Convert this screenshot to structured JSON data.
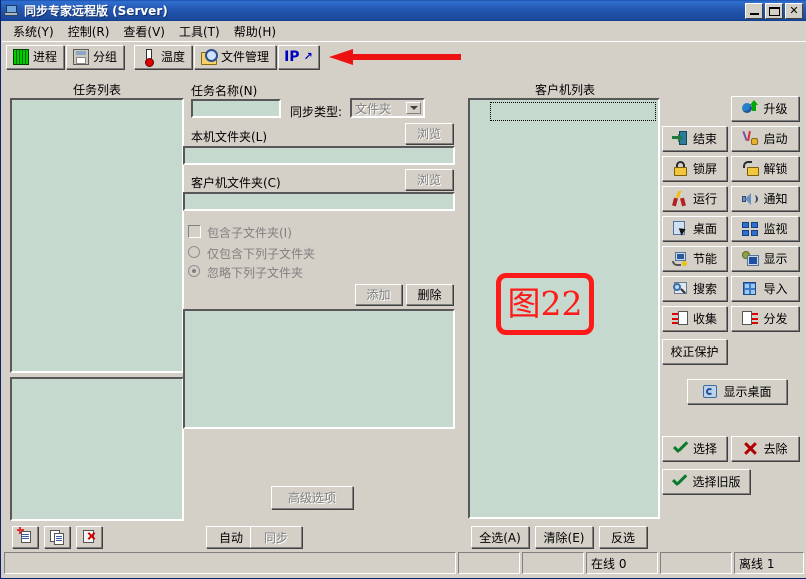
{
  "window": {
    "title": "同步专家远程版 (Server)",
    "icon": "computer-icon",
    "minimize": "minimize-icon",
    "maximize": "maximize-icon",
    "close": "close-icon"
  },
  "menubar": [
    {
      "label": "系统(Y)"
    },
    {
      "label": "控制(R)"
    },
    {
      "label": "查看(V)"
    },
    {
      "label": "工具(T)"
    },
    {
      "label": "帮助(H)"
    }
  ],
  "toolbar": [
    {
      "label": "进程",
      "icon": "process-icon"
    },
    {
      "label": "分组",
      "icon": "group-icon"
    },
    {
      "label": "温度",
      "icon": "thermometer-icon"
    },
    {
      "label": "文件管理",
      "icon": "file-manager-icon"
    },
    {
      "label": "IP",
      "icon": "ip-icon"
    }
  ],
  "annotation": {
    "arrow": "red-arrow-pointing-left",
    "figure_label": "图22",
    "color": "#ff1a1a"
  },
  "task_panel": {
    "list_title": "任务列表",
    "upper_list_value": "",
    "lower_list_value": ""
  },
  "task_form": {
    "name_label": "任务名称(N)",
    "name_value": "",
    "sync_type_label": "同步类型:",
    "sync_type_value": "文件夹",
    "local_folder_label": "本机文件夹(L)",
    "local_folder_value": "",
    "local_browse_label": "浏览",
    "client_folder_label": "客户机文件夹(C)",
    "client_folder_value": "",
    "client_browse_label": "浏览",
    "include_sub_label": "包含子文件夹(I)",
    "include_sub_checked": false,
    "radio_only_label": "仅包含下列子文件夹",
    "radio_ignore_label": "忽略下列子文件夹",
    "radio_selected": "ignore",
    "add_label": "添加",
    "delete_label": "删除",
    "sub_list_value": "",
    "advanced_label": "高级选项"
  },
  "task_footer": {
    "new_icon": "new-task-icon",
    "copy_icon": "copy-task-icon",
    "delete_icon": "delete-task-icon",
    "auto_label": "自动",
    "sync_label": "同步"
  },
  "client_panel": {
    "title": "客户机列表",
    "selection_row_value": "",
    "select_all_label": "全选(A)",
    "clear_label": "清除(E)",
    "invert_label": "反选"
  },
  "side_buttons": [
    {
      "label": "升级",
      "icon": "upgrade-icon"
    },
    {
      "label": "结束",
      "icon": "end-icon"
    },
    {
      "label": "启动",
      "icon": "start-icon"
    },
    {
      "label": "锁屏",
      "icon": "lock-screen-icon"
    },
    {
      "label": "解锁",
      "icon": "unlock-icon"
    },
    {
      "label": "运行",
      "icon": "run-icon"
    },
    {
      "label": "通知",
      "icon": "notify-speaker-icon"
    },
    {
      "label": "桌面",
      "icon": "desktop-icon"
    },
    {
      "label": "监视",
      "icon": "monitor-grid-icon"
    },
    {
      "label": "节能",
      "icon": "power-save-icon"
    },
    {
      "label": "显示",
      "icon": "display-icon"
    },
    {
      "label": "搜索",
      "icon": "search-icon"
    },
    {
      "label": "导入",
      "icon": "import-icon"
    },
    {
      "label": "收集",
      "icon": "collect-icon"
    },
    {
      "label": "分发",
      "icon": "distribute-icon"
    },
    {
      "label": "校正保护",
      "icon": "none"
    },
    {
      "label": "显示桌面",
      "icon": "show-desktop-icon"
    },
    {
      "label": "选择",
      "icon": "check-icon"
    },
    {
      "label": "去除",
      "icon": "cross-icon"
    },
    {
      "label": "选择旧版",
      "icon": "check-icon"
    }
  ],
  "statusbar": {
    "cell1": "",
    "cell2": "",
    "cell3": "",
    "online": "在线 0",
    "cell5": "",
    "offline": "离线 1"
  }
}
